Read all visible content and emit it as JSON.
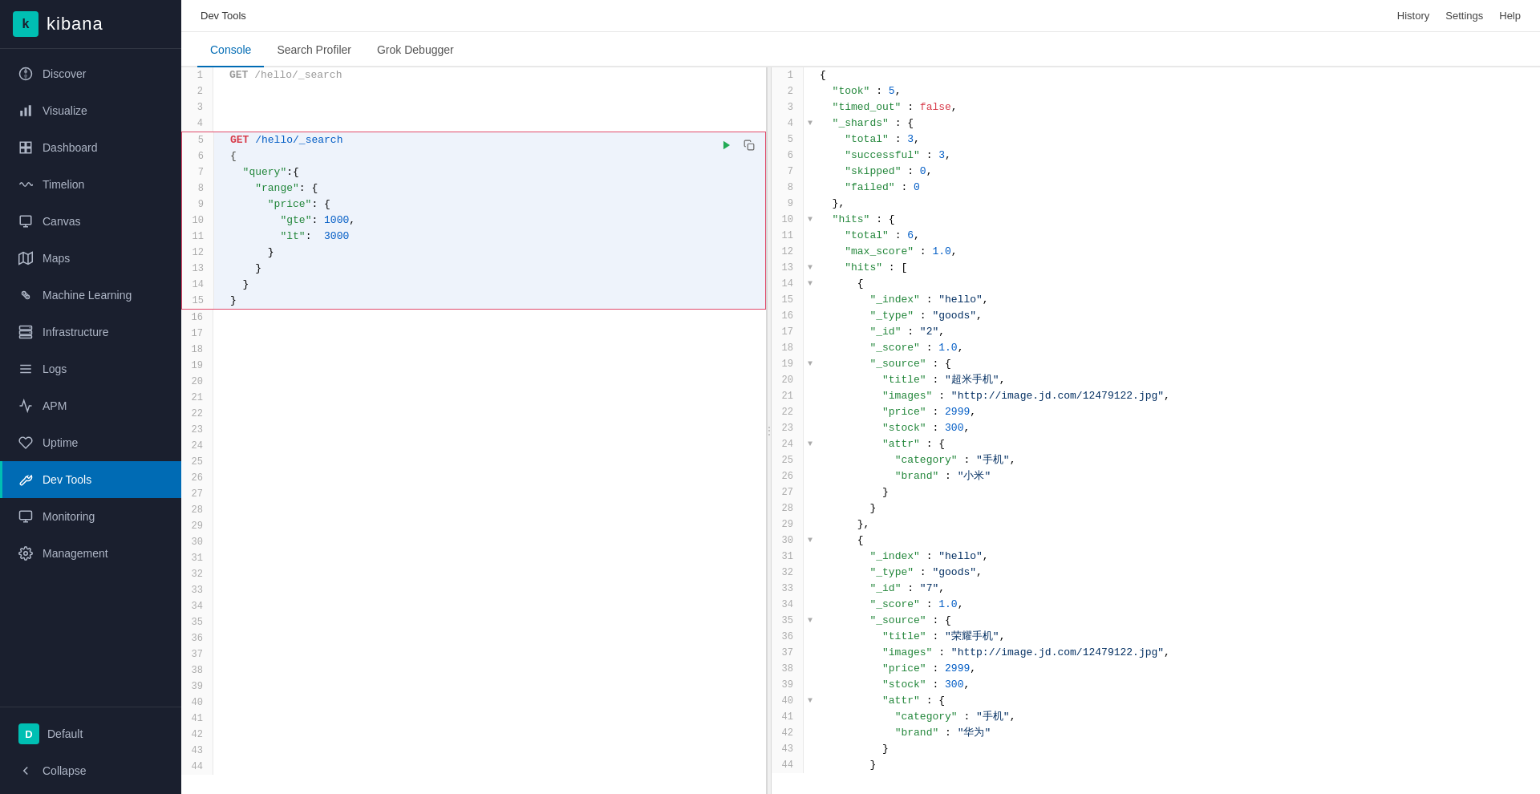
{
  "app": {
    "title": "Dev Tools"
  },
  "header": {
    "title": "Dev Tools",
    "history": "History",
    "settings": "Settings",
    "help": "Help"
  },
  "logo": {
    "letter": "k",
    "name": "kibana"
  },
  "sidebar": {
    "items": [
      {
        "id": "discover",
        "label": "Discover",
        "icon": "compass"
      },
      {
        "id": "visualize",
        "label": "Visualize",
        "icon": "bar-chart"
      },
      {
        "id": "dashboard",
        "label": "Dashboard",
        "icon": "grid"
      },
      {
        "id": "timelion",
        "label": "Timelion",
        "icon": "wave"
      },
      {
        "id": "canvas",
        "label": "Canvas",
        "icon": "canvas"
      },
      {
        "id": "maps",
        "label": "Maps",
        "icon": "map"
      },
      {
        "id": "machine-learning",
        "label": "Machine Learning",
        "icon": "brain"
      },
      {
        "id": "infrastructure",
        "label": "Infrastructure",
        "icon": "server"
      },
      {
        "id": "logs",
        "label": "Logs",
        "icon": "list"
      },
      {
        "id": "apm",
        "label": "APM",
        "icon": "activity"
      },
      {
        "id": "uptime",
        "label": "Uptime",
        "icon": "heart"
      },
      {
        "id": "dev-tools",
        "label": "Dev Tools",
        "icon": "wrench",
        "active": true
      },
      {
        "id": "monitoring",
        "label": "Monitoring",
        "icon": "monitor"
      },
      {
        "id": "management",
        "label": "Management",
        "icon": "gear"
      }
    ],
    "bottom": [
      {
        "id": "default",
        "label": "Default",
        "icon": "user"
      },
      {
        "id": "collapse",
        "label": "Collapse",
        "icon": "arrow-left"
      }
    ]
  },
  "tabs": [
    {
      "id": "console",
      "label": "Console",
      "active": true
    },
    {
      "id": "search-profiler",
      "label": "Search Profiler",
      "active": false
    },
    {
      "id": "grok-debugger",
      "label": "Grok Debugger",
      "active": false
    }
  ],
  "left_editor": {
    "lines": [
      {
        "num": 1,
        "content": "GET /hello/_search",
        "type": "normal",
        "fold": ""
      },
      {
        "num": 2,
        "content": "",
        "type": "normal",
        "fold": ""
      },
      {
        "num": 3,
        "content": "",
        "type": "normal",
        "fold": ""
      },
      {
        "num": 4,
        "content": "",
        "type": "normal",
        "fold": ""
      },
      {
        "num": 5,
        "content": "GET /hello/_search",
        "type": "highlight",
        "fold": ""
      },
      {
        "num": 6,
        "content": "{",
        "type": "highlight",
        "fold": ""
      },
      {
        "num": 7,
        "content": "  \"query\":{",
        "type": "highlight",
        "fold": ""
      },
      {
        "num": 8,
        "content": "    \"range\": {",
        "type": "highlight",
        "fold": ""
      },
      {
        "num": 9,
        "content": "      \"price\": {",
        "type": "highlight",
        "fold": ""
      },
      {
        "num": 10,
        "content": "        \"gte\": 1000,",
        "type": "highlight",
        "fold": ""
      },
      {
        "num": 11,
        "content": "        \"lt\":  3000",
        "type": "highlight",
        "fold": ""
      },
      {
        "num": 12,
        "content": "      }",
        "type": "highlight",
        "fold": ""
      },
      {
        "num": 13,
        "content": "    }",
        "type": "highlight",
        "fold": ""
      },
      {
        "num": 14,
        "content": "  }",
        "type": "highlight",
        "fold": ""
      },
      {
        "num": 15,
        "content": "}",
        "type": "highlight",
        "fold": ""
      },
      {
        "num": 16,
        "content": "",
        "type": "normal",
        "fold": ""
      },
      {
        "num": 17,
        "content": "",
        "type": "normal",
        "fold": ""
      },
      {
        "num": 18,
        "content": "",
        "type": "normal",
        "fold": ""
      },
      {
        "num": 19,
        "content": "",
        "type": "normal",
        "fold": ""
      },
      {
        "num": 20,
        "content": "",
        "type": "normal",
        "fold": ""
      },
      {
        "num": 21,
        "content": "",
        "type": "normal",
        "fold": ""
      },
      {
        "num": 22,
        "content": "",
        "type": "normal",
        "fold": ""
      },
      {
        "num": 23,
        "content": "",
        "type": "normal",
        "fold": ""
      },
      {
        "num": 24,
        "content": "",
        "type": "normal",
        "fold": ""
      },
      {
        "num": 25,
        "content": "",
        "type": "normal",
        "fold": ""
      },
      {
        "num": 26,
        "content": "",
        "type": "normal",
        "fold": ""
      },
      {
        "num": 27,
        "content": "",
        "type": "normal",
        "fold": ""
      },
      {
        "num": 28,
        "content": "",
        "type": "normal",
        "fold": ""
      },
      {
        "num": 29,
        "content": "",
        "type": "normal",
        "fold": ""
      },
      {
        "num": 30,
        "content": "",
        "type": "normal",
        "fold": ""
      },
      {
        "num": 31,
        "content": "",
        "type": "normal",
        "fold": ""
      },
      {
        "num": 32,
        "content": "",
        "type": "normal",
        "fold": ""
      },
      {
        "num": 33,
        "content": "",
        "type": "normal",
        "fold": ""
      },
      {
        "num": 34,
        "content": "",
        "type": "normal",
        "fold": ""
      },
      {
        "num": 35,
        "content": "",
        "type": "normal",
        "fold": ""
      },
      {
        "num": 36,
        "content": "",
        "type": "normal",
        "fold": ""
      },
      {
        "num": 37,
        "content": "",
        "type": "normal",
        "fold": ""
      },
      {
        "num": 38,
        "content": "",
        "type": "normal",
        "fold": ""
      },
      {
        "num": 39,
        "content": "",
        "type": "normal",
        "fold": ""
      },
      {
        "num": 40,
        "content": "",
        "type": "normal",
        "fold": ""
      },
      {
        "num": 41,
        "content": "",
        "type": "normal",
        "fold": ""
      },
      {
        "num": 42,
        "content": "",
        "type": "normal",
        "fold": ""
      },
      {
        "num": 43,
        "content": "",
        "type": "normal",
        "fold": ""
      },
      {
        "num": 44,
        "content": "",
        "type": "normal",
        "fold": ""
      }
    ]
  },
  "right_editor": {
    "lines": [
      {
        "num": 1,
        "content": "{",
        "fold": ""
      },
      {
        "num": 2,
        "content": "  \"took\" : 5,",
        "fold": ""
      },
      {
        "num": 3,
        "content": "  \"timed_out\" : false,",
        "fold": ""
      },
      {
        "num": 4,
        "content": "  \"_shards\" : {",
        "fold": "▼"
      },
      {
        "num": 5,
        "content": "    \"total\" : 3,",
        "fold": ""
      },
      {
        "num": 6,
        "content": "    \"successful\" : 3,",
        "fold": ""
      },
      {
        "num": 7,
        "content": "    \"skipped\" : 0,",
        "fold": ""
      },
      {
        "num": 8,
        "content": "    \"failed\" : 0",
        "fold": ""
      },
      {
        "num": 9,
        "content": "  },",
        "fold": ""
      },
      {
        "num": 10,
        "content": "  \"hits\" : {",
        "fold": "▼"
      },
      {
        "num": 11,
        "content": "    \"total\" : 6,",
        "fold": ""
      },
      {
        "num": 12,
        "content": "    \"max_score\" : 1.0,",
        "fold": ""
      },
      {
        "num": 13,
        "content": "    \"hits\" : [",
        "fold": "▼"
      },
      {
        "num": 14,
        "content": "      {",
        "fold": "▼"
      },
      {
        "num": 15,
        "content": "        \"_index\" : \"hello\",",
        "fold": ""
      },
      {
        "num": 16,
        "content": "        \"_type\" : \"goods\",",
        "fold": ""
      },
      {
        "num": 17,
        "content": "        \"_id\" : \"2\",",
        "fold": ""
      },
      {
        "num": 18,
        "content": "        \"_score\" : 1.0,",
        "fold": ""
      },
      {
        "num": 19,
        "content": "        \"_source\" : {",
        "fold": "▼"
      },
      {
        "num": 20,
        "content": "          \"title\" : \"超米手机\",",
        "fold": ""
      },
      {
        "num": 21,
        "content": "          \"images\" : \"http://image.jd.com/12479122.jpg\",",
        "fold": ""
      },
      {
        "num": 22,
        "content": "          \"price\" : 2999,",
        "fold": ""
      },
      {
        "num": 23,
        "content": "          \"stock\" : 300,",
        "fold": ""
      },
      {
        "num": 24,
        "content": "          \"attr\" : {",
        "fold": "▼"
      },
      {
        "num": 25,
        "content": "            \"category\" : \"手机\",",
        "fold": ""
      },
      {
        "num": 26,
        "content": "            \"brand\" : \"小米\"",
        "fold": ""
      },
      {
        "num": 27,
        "content": "          }",
        "fold": ""
      },
      {
        "num": 28,
        "content": "        }",
        "fold": ""
      },
      {
        "num": 29,
        "content": "      },",
        "fold": ""
      },
      {
        "num": 30,
        "content": "      {",
        "fold": "▼"
      },
      {
        "num": 31,
        "content": "        \"_index\" : \"hello\",",
        "fold": ""
      },
      {
        "num": 32,
        "content": "        \"_type\" : \"goods\",",
        "fold": ""
      },
      {
        "num": 33,
        "content": "        \"_id\" : \"7\",",
        "fold": ""
      },
      {
        "num": 34,
        "content": "        \"_score\" : 1.0,",
        "fold": ""
      },
      {
        "num": 35,
        "content": "        \"_source\" : {",
        "fold": "▼"
      },
      {
        "num": 36,
        "content": "          \"title\" : \"荣耀手机\",",
        "fold": ""
      },
      {
        "num": 37,
        "content": "          \"images\" : \"http://image.jd.com/12479122.jpg\",",
        "fold": ""
      },
      {
        "num": 38,
        "content": "          \"price\" : 2999,",
        "fold": ""
      },
      {
        "num": 39,
        "content": "          \"stock\" : 300,",
        "fold": ""
      },
      {
        "num": 40,
        "content": "          \"attr\" : {",
        "fold": "▼"
      },
      {
        "num": 41,
        "content": "            \"category\" : \"手机\",",
        "fold": ""
      },
      {
        "num": 42,
        "content": "            \"brand\" : \"华为\"",
        "fold": ""
      },
      {
        "num": 43,
        "content": "          }",
        "fold": ""
      },
      {
        "num": 44,
        "content": "        }",
        "fold": ""
      }
    ]
  }
}
